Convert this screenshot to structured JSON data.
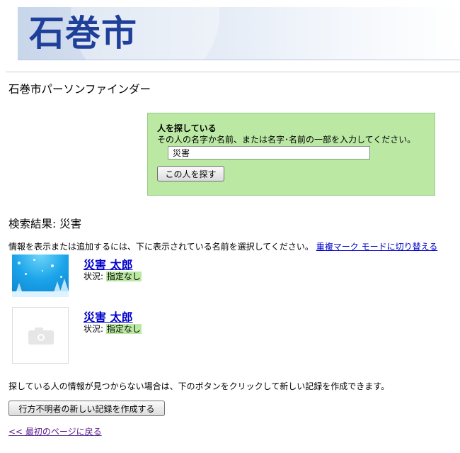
{
  "header": {
    "logo_text": "石巻市",
    "app_title": "石巻市パーソンファインダー"
  },
  "search": {
    "heading": "人を探している",
    "instruction": "その人の名字か名前、または名字･名前の一部を入力してください。",
    "input_value": "災害",
    "button_label": "この人を探す"
  },
  "results": {
    "heading_label": "検索結果: ",
    "query": "災害",
    "instruction": "情報を表示または追加するには、下に表示されている名前を選択してください。",
    "duplicate_mode_link": "重複マーク モードに切り替える",
    "items": [
      {
        "name": "災害 太郎",
        "status_label": "状況: ",
        "status_value": "指定なし",
        "photo": "winter-scene"
      },
      {
        "name": "災害 太郎",
        "status_label": "状況: ",
        "status_value": "指定なし",
        "photo": "camera-icon"
      }
    ]
  },
  "footer": {
    "no_match_text": "探している人の情報が見つからない場合は、下のボタンをクリックして新しい記録を作成できます。",
    "create_button_label": "行方不明者の新しい記録を作成する",
    "back_link": "<< 最初のページに戻る"
  },
  "colors": {
    "search_box_bg": "#bbe9a4",
    "logo_text": "#1e3f9a",
    "link": "#0000cc",
    "visited_link": "#551a8b"
  }
}
